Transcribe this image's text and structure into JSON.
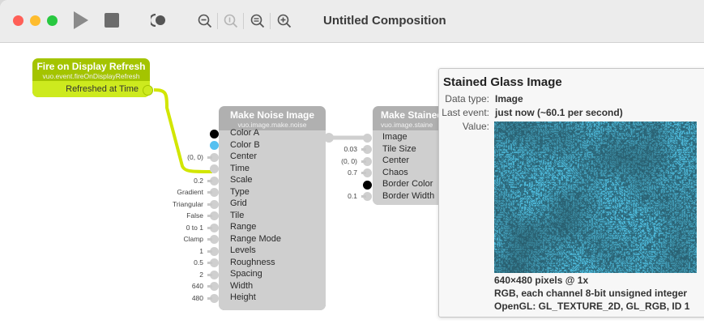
{
  "window": {
    "title": "Untitled Composition"
  },
  "colors": {
    "close": "#ff5f57",
    "minimize": "#febc2e",
    "zoom": "#28c840",
    "event_node": "#a4c400",
    "gray_node": "#b0b0b0",
    "cable_event": "#d2e600",
    "cable_data": "#cfcfcf"
  },
  "toolbar": {
    "run_icon": "play-icon",
    "stop_icon": "stop-icon",
    "show_events_icon": "show-events-icon",
    "zoom_out_icon": "zoom-out-icon",
    "zoom_actual_icon": "zoom-actual-size-icon",
    "zoom_fit_icon": "zoom-to-fit-icon",
    "zoom_in_icon": "zoom-in-icon"
  },
  "fire_node": {
    "title": "Fire on Display Refresh",
    "subtitle": "vuo.event.fireOnDisplayRefresh",
    "output": "Refreshed at Time"
  },
  "noise_node": {
    "title": "Make Noise Image",
    "subtitle": "vuo.image.make.noise",
    "ports": [
      {
        "label": "Color A",
        "value": ""
      },
      {
        "label": "Color B",
        "value": ""
      },
      {
        "label": "Center",
        "value": "(0, 0)"
      },
      {
        "label": "Time",
        "value": ""
      },
      {
        "label": "Scale",
        "value": "0.2"
      },
      {
        "label": "Type",
        "value": "Gradient"
      },
      {
        "label": "Grid",
        "value": "Triangular"
      },
      {
        "label": "Tile",
        "value": "False"
      },
      {
        "label": "Range",
        "value": "0 to 1"
      },
      {
        "label": "Range Mode",
        "value": "Clamp"
      },
      {
        "label": "Levels",
        "value": "1"
      },
      {
        "label": "Roughness",
        "value": "0.5"
      },
      {
        "label": "Spacing",
        "value": "2"
      },
      {
        "label": "Width",
        "value": "640"
      },
      {
        "label": "Height",
        "value": "480"
      }
    ]
  },
  "stained_node": {
    "title": "Make Stained",
    "subtitle": "vuo.image.staine",
    "ports": [
      {
        "label": "Image",
        "value": ""
      },
      {
        "label": "Tile Size",
        "value": "0.03"
      },
      {
        "label": "Center",
        "value": "(0, 0)"
      },
      {
        "label": "Chaos",
        "value": "0.7"
      },
      {
        "label": "Border Color",
        "value": ""
      },
      {
        "label": "Border Width",
        "value": "0.1"
      }
    ]
  },
  "popover": {
    "title": "Stained Glass Image",
    "data_type_label": "Data type:",
    "data_type": "Image",
    "last_event_label": "Last event:",
    "last_event": "just now (~60.1 per second)",
    "value_label": "Value:",
    "info_line1": "640×480 pixels @ 1x",
    "info_line2": "RGB, each channel 8-bit unsigned integer",
    "info_line3": "OpenGL: GL_TEXTURE_2D, GL_RGB, ID 1"
  }
}
